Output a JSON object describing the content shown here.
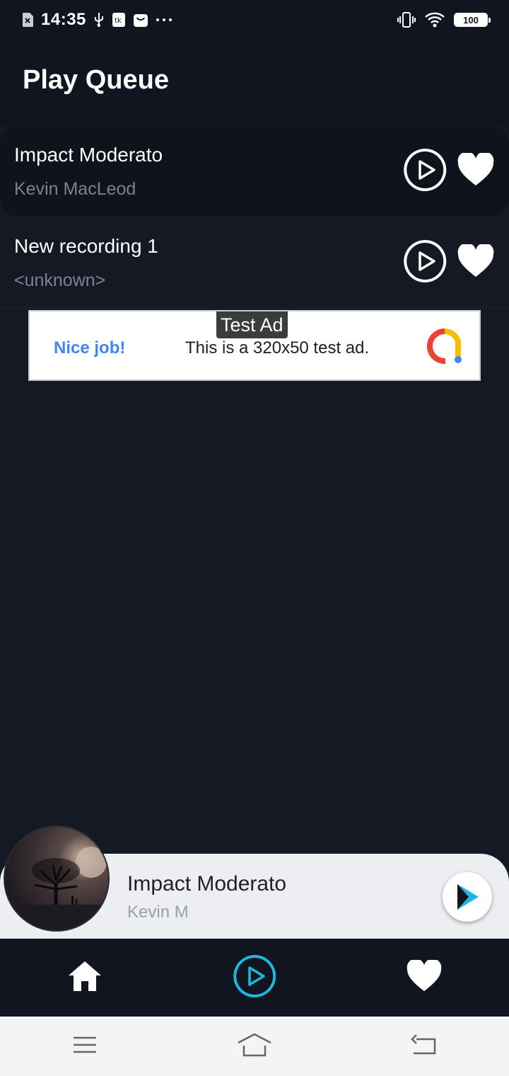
{
  "status_bar": {
    "time": "14:35",
    "battery": "100",
    "icons_left": [
      "sim-off-icon",
      "usb-icon",
      "notification-icon",
      "bag-icon",
      "more-dots-icon"
    ],
    "icons_right": [
      "vibrate-icon",
      "wifi-icon",
      "battery-icon"
    ]
  },
  "header": {
    "title": "Play Queue"
  },
  "queue": [
    {
      "title": "Impact Moderato",
      "artist": "Kevin MacLeod"
    },
    {
      "title": "New recording 1",
      "artist": "<unknown>"
    }
  ],
  "ad": {
    "label": "Test Ad",
    "cta": "Nice job!",
    "text": "This is a 320x50 test ad."
  },
  "mini_player": {
    "title": "Impact Moderato",
    "artist": "Kevin M"
  },
  "bottom_nav": [
    "home-icon",
    "play-icon",
    "heart-icon"
  ],
  "colors": {
    "background": "#151923",
    "bar": "#111520",
    "accent": "#1fb6e0",
    "muted_text": "#7c8293",
    "mini_player_bg": "#eceef1"
  }
}
